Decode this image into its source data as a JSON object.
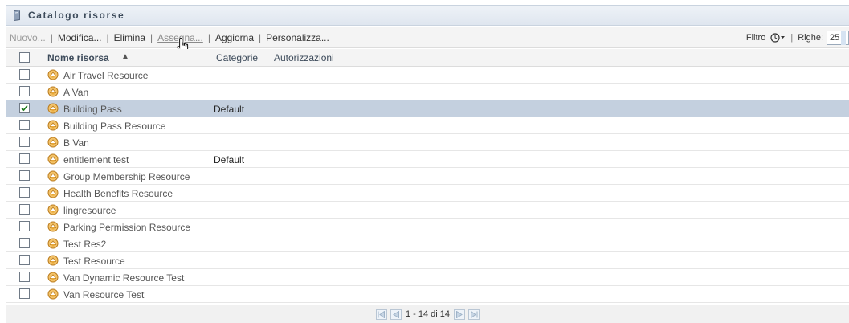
{
  "title": "Catalogo risorse",
  "toolbar": {
    "items": [
      {
        "label": "Nuovo...",
        "state": "disabled"
      },
      {
        "label": "Modifica...",
        "state": "normal"
      },
      {
        "label": "Elimina",
        "state": "normal"
      },
      {
        "label": "Assegna...",
        "state": "hover"
      },
      {
        "label": "Aggiorna",
        "state": "normal"
      },
      {
        "label": "Personalizza...",
        "state": "normal"
      }
    ],
    "separator": "|",
    "filter_label": "Filtro",
    "rows_label": "Righe:",
    "rows_value": "25"
  },
  "table": {
    "columns": {
      "name": "Nome risorsa",
      "sort_indicator": "▲",
      "categories": "Categorie",
      "authorizations": "Autorizzazioni"
    },
    "rows": [
      {
        "name": "Air Travel Resource",
        "category": "",
        "checked": false
      },
      {
        "name": "A Van",
        "category": "",
        "checked": false
      },
      {
        "name": "Building Pass",
        "category": "Default",
        "checked": true
      },
      {
        "name": "Building Pass Resource",
        "category": "",
        "checked": false
      },
      {
        "name": "B Van",
        "category": "",
        "checked": false
      },
      {
        "name": "entitlement test",
        "category": "Default",
        "checked": false
      },
      {
        "name": "Group Membership Resource",
        "category": "",
        "checked": false
      },
      {
        "name": "Health Benefits Resource",
        "category": "",
        "checked": false
      },
      {
        "name": "lingresource",
        "category": "",
        "checked": false
      },
      {
        "name": "Parking Permission Resource",
        "category": "",
        "checked": false
      },
      {
        "name": "Test Res2",
        "category": "",
        "checked": false
      },
      {
        "name": "Test Resource",
        "category": "",
        "checked": false
      },
      {
        "name": "Van Dynamic Resource Test",
        "category": "",
        "checked": false
      },
      {
        "name": "Van Resource Test",
        "category": "",
        "checked": false
      }
    ]
  },
  "pagination": {
    "text": "1 - 14 di 14"
  },
  "colors": {
    "selected_row": "#c4d0df",
    "title_bar": "#dfe6ef",
    "resource_icon": "#e8a838"
  },
  "icons": {
    "title": "catalog-book-icon",
    "resource": "resource-badge-icon",
    "filter": "filter-icon",
    "cursor": "hand-pointer-icon"
  }
}
